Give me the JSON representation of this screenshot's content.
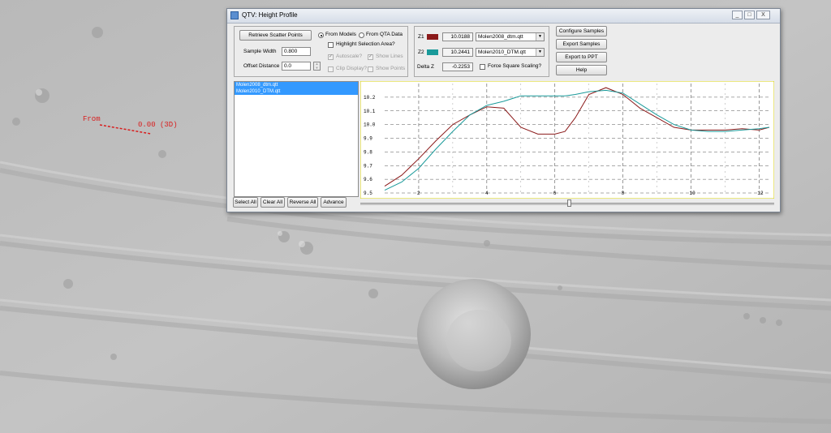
{
  "window": {
    "title": "QTV: Height Profile",
    "controls": [
      "_",
      "□",
      "X"
    ]
  },
  "annotation": {
    "from_label": "From",
    "value_label": "0.00 (3D)"
  },
  "left_panel": {
    "retrieve_button": "Retrieve Scatter Points",
    "sample_width_label": "Sample Width",
    "sample_width_value": "0.800",
    "offset_distance_label": "Offset Distance",
    "offset_distance_value": "0.0"
  },
  "options": {
    "from_models": "From Models",
    "from_qta_data": "From QTA Data",
    "highlight_selection": "Highlight Selection Area?",
    "autoscale": "Autoscale?",
    "show_lines": "Show Lines",
    "clip_display": "Clip Display?",
    "show_points": "Show Points"
  },
  "z_panel": {
    "z1_label": "Z1",
    "z1_value": "10.0188",
    "z1_model": "Molen2008_dtm.qtt",
    "z1_color": "#8b1a1a",
    "z2_label": "Z2",
    "z2_value": "10.2441",
    "z2_model": "Molen2010_DTM.qtt",
    "z2_color": "#1a9a9a",
    "delta_label": "Delta Z",
    "delta_value": "-0.2253",
    "force_square": "Force Square Scaling?"
  },
  "actions": {
    "configure": "Configure Samples",
    "export_samples": "Export Samples",
    "export_ppt": "Export to PPT",
    "help": "Help"
  },
  "file_list": {
    "items": [
      "Molen2008_dtm.qtt",
      "Molen2010_DTM.qtt"
    ]
  },
  "list_buttons": {
    "select_all": "Select All",
    "clear_all": "Clear All",
    "reverse_all": "Reverse All",
    "advance": "Advance"
  },
  "chart_data": {
    "type": "line",
    "title": "",
    "xlabel": "",
    "ylabel": "",
    "xlim": [
      1,
      12.3
    ],
    "ylim": [
      9.5,
      10.3
    ],
    "x_ticks": [
      "2",
      "4",
      "6",
      "8",
      "10",
      "12"
    ],
    "x_tick_values": [
      2,
      4,
      6,
      8,
      10,
      12
    ],
    "y_ticks": [
      "9.5",
      "9.6",
      "9.7",
      "9.8",
      "9.9",
      "10.0",
      "10.1",
      "10.2"
    ],
    "y_tick_values": [
      9.5,
      9.6,
      9.7,
      9.8,
      9.9,
      10.0,
      10.1,
      10.2
    ],
    "grid": true,
    "series": [
      {
        "name": "Molen2008_dtm.qtt",
        "color": "#8b1a1a",
        "x": [
          1,
          1.5,
          2,
          2.5,
          3,
          3.5,
          4,
          4.5,
          5,
          5.5,
          6,
          6.3,
          6.6,
          7,
          7.5,
          8,
          8.5,
          9,
          9.5,
          10,
          10.5,
          11,
          11.5,
          12,
          12.3
        ],
        "y": [
          9.55,
          9.63,
          9.75,
          9.88,
          10.0,
          10.07,
          10.13,
          10.12,
          9.98,
          9.93,
          9.93,
          9.95,
          10.05,
          10.22,
          10.27,
          10.22,
          10.12,
          10.05,
          9.98,
          9.96,
          9.96,
          9.96,
          9.97,
          9.96,
          9.98
        ]
      },
      {
        "name": "Molen2010_DTM.qtt",
        "color": "#1a9a9a",
        "x": [
          1,
          1.5,
          2,
          2.5,
          3,
          3.5,
          4,
          4.5,
          5,
          5.5,
          6,
          6.3,
          6.6,
          7,
          7.5,
          8,
          8.5,
          9,
          9.5,
          10,
          10.5,
          11,
          11.5,
          12,
          12.3
        ],
        "y": [
          9.52,
          9.58,
          9.68,
          9.82,
          9.95,
          10.07,
          10.14,
          10.17,
          10.21,
          10.21,
          10.21,
          10.21,
          10.22,
          10.24,
          10.25,
          10.23,
          10.15,
          10.07,
          10.0,
          9.96,
          9.95,
          9.95,
          9.96,
          9.97,
          9.98
        ]
      }
    ]
  }
}
